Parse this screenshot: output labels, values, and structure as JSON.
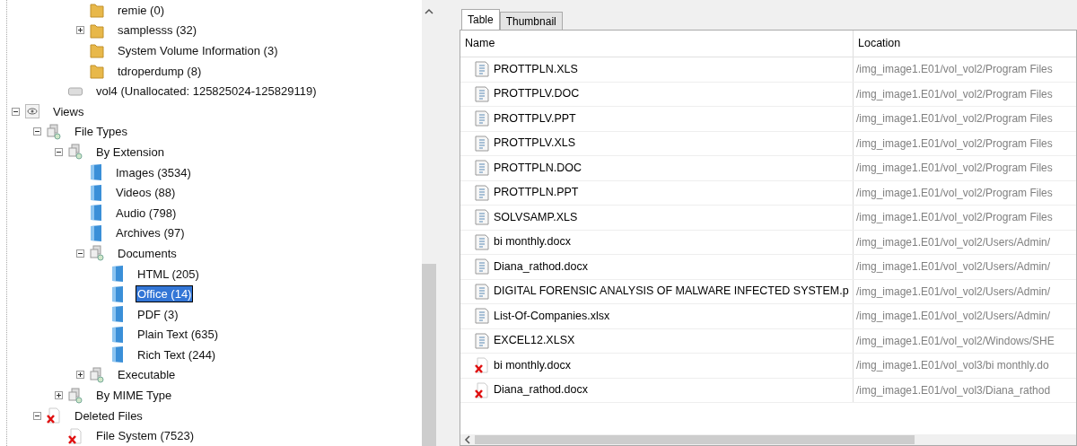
{
  "tree": [
    {
      "children": [
        {
          "children": [
            {
              "children": [
                {
                  "label": "remie (0)",
                  "kind": "folder"
                },
                {
                  "label": "samplesss (32)",
                  "kind": "folder",
                  "expanded": false
                },
                {
                  "label": "System Volume Information (3)",
                  "kind": "folder"
                },
                {
                  "label": "tdroperdump (8)",
                  "kind": "folder"
                }
              ]
            },
            {
              "label": "vol4 (Unallocated: 125825024-125829119)",
              "kind": "disk"
            }
          ]
        }
      ]
    },
    {
      "label": "Views",
      "kind": "views",
      "expanded": true,
      "children": [
        {
          "label": "File Types",
          "kind": "group",
          "expanded": true,
          "children": [
            {
              "label": "By Extension",
              "kind": "group",
              "expanded": true,
              "children": [
                {
                  "label": "Images (3534)",
                  "kind": "doc",
                  "selected": false
                },
                {
                  "label": "Videos (88)",
                  "kind": "doc",
                  "selected": false
                },
                {
                  "label": "Audio (798)",
                  "kind": "doc",
                  "selected": false
                },
                {
                  "label": "Archives (97)",
                  "kind": "doc",
                  "selected": false
                },
                {
                  "label": "Documents",
                  "kind": "group",
                  "expanded": true,
                  "children": [
                    {
                      "label": "HTML (205)",
                      "kind": "doc",
                      "selected": false
                    },
                    {
                      "label": "Office (14)",
                      "kind": "doc",
                      "selected": true
                    },
                    {
                      "label": "PDF (3)",
                      "kind": "doc",
                      "selected": false
                    },
                    {
                      "label": "Plain Text (635)",
                      "kind": "doc",
                      "selected": false
                    },
                    {
                      "label": "Rich Text (244)",
                      "kind": "doc",
                      "selected": false
                    }
                  ]
                },
                {
                  "label": "Executable",
                  "kind": "group",
                  "expanded": false
                }
              ]
            },
            {
              "label": "By MIME Type",
              "kind": "group",
              "expanded": false
            }
          ]
        },
        {
          "label": "Deleted Files",
          "kind": "deleted",
          "expanded": true,
          "children": [
            {
              "label": "File System (7523)",
              "kind": "deleted"
            }
          ]
        }
      ]
    }
  ],
  "tabs": [
    {
      "label": "Table",
      "selected": true
    },
    {
      "label": "Thumbnail",
      "selected": false
    }
  ],
  "table": {
    "columns": [
      "Name",
      "Location"
    ],
    "rows": [
      {
        "kind": "file",
        "name": "PROTTPLN.XLS",
        "location": "/img_image1.E01/vol_vol2/Program Files"
      },
      {
        "kind": "file",
        "name": "PROTTPLV.DOC",
        "location": "/img_image1.E01/vol_vol2/Program Files"
      },
      {
        "kind": "file",
        "name": "PROTTPLV.PPT",
        "location": "/img_image1.E01/vol_vol2/Program Files"
      },
      {
        "kind": "file",
        "name": "PROTTPLV.XLS",
        "location": "/img_image1.E01/vol_vol2/Program Files"
      },
      {
        "kind": "file",
        "name": "PROTTPLN.DOC",
        "location": "/img_image1.E01/vol_vol2/Program Files"
      },
      {
        "kind": "file",
        "name": "PROTTPLN.PPT",
        "location": "/img_image1.E01/vol_vol2/Program Files"
      },
      {
        "kind": "file",
        "name": "SOLVSAMP.XLS",
        "location": "/img_image1.E01/vol_vol2/Program Files"
      },
      {
        "kind": "file",
        "name": "bi monthly.docx",
        "location": "/img_image1.E01/vol_vol2/Users/Admin/"
      },
      {
        "kind": "file",
        "name": "Diana_rathod.docx",
        "location": "/img_image1.E01/vol_vol2/Users/Admin/"
      },
      {
        "kind": "file",
        "name": "DIGITAL FORENSIC ANALYSIS OF MALWARE INFECTED SYSTEM.p",
        "location": "/img_image1.E01/vol_vol2/Users/Admin/"
      },
      {
        "kind": "file",
        "name": "List-Of-Companies.xlsx",
        "location": "/img_image1.E01/vol_vol2/Users/Admin/"
      },
      {
        "kind": "file",
        "name": "EXCEL12.XLSX",
        "location": "/img_image1.E01/vol_vol2/Windows/SHE"
      },
      {
        "kind": "deleted",
        "name": "bi monthly.docx",
        "location": "/img_image1.E01/vol_vol3/bi monthly.do"
      },
      {
        "kind": "deleted",
        "name": "Diana_rathod.docx",
        "location": "/img_image1.E01/vol_vol3/Diana_rathod"
      }
    ]
  }
}
